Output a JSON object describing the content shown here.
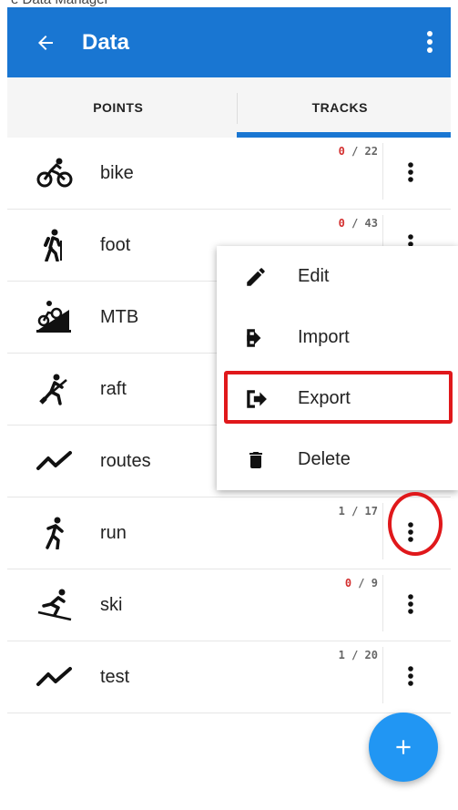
{
  "header": {
    "partial_caption": "e Data Manager",
    "title": "Data"
  },
  "tabs": [
    {
      "label": "POINTS",
      "active": false
    },
    {
      "label": "TRACKS",
      "active": true
    }
  ],
  "rows": [
    {
      "name": "bike",
      "icon": "bike-icon",
      "visible": "0",
      "total": "22"
    },
    {
      "name": "foot",
      "icon": "hiking-icon",
      "visible": "0",
      "total": "43"
    },
    {
      "name": "MTB",
      "icon": "mountain-bike-icon",
      "visible": "",
      "total": ""
    },
    {
      "name": "raft",
      "icon": "rafting-icon",
      "visible": "",
      "total": ""
    },
    {
      "name": "routes",
      "icon": "route-line-icon",
      "visible": "",
      "total": ""
    },
    {
      "name": "run",
      "icon": "running-icon",
      "visible": "1",
      "total": "17"
    },
    {
      "name": "ski",
      "icon": "skiing-icon",
      "visible": "0",
      "total": "9"
    },
    {
      "name": "test",
      "icon": "route-line-icon",
      "visible": "1",
      "total": "20"
    }
  ],
  "menu": {
    "items": [
      {
        "label": "Edit",
        "icon": "pencil-icon"
      },
      {
        "label": "Import",
        "icon": "import-icon"
      },
      {
        "label": "Export",
        "icon": "export-icon"
      },
      {
        "label": "Delete",
        "icon": "trash-icon"
      }
    ]
  },
  "fab": {
    "icon": "plus-icon"
  },
  "colors": {
    "primary": "#1976d2",
    "accent": "#2196f3",
    "highlight": "#e0181b",
    "count_zero": "#d32f2f"
  }
}
